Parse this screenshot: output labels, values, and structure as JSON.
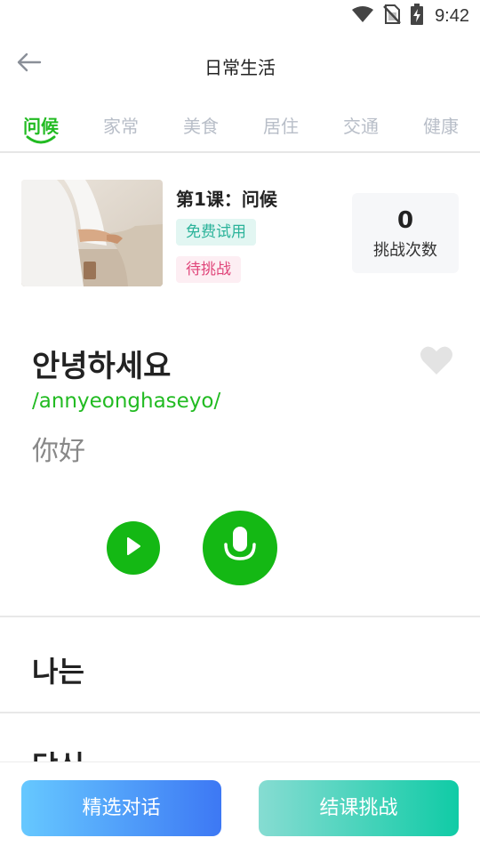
{
  "status_bar": {
    "time": "9:42",
    "icons": [
      "wifi-icon",
      "no-sim-icon",
      "battery-charging-icon"
    ]
  },
  "header": {
    "back_icon": "arrow-left-icon",
    "title": "日常生活"
  },
  "tabs": [
    {
      "label": "问候",
      "active": true
    },
    {
      "label": "家常",
      "active": false
    },
    {
      "label": "美食",
      "active": false
    },
    {
      "label": "居住",
      "active": false
    },
    {
      "label": "交通",
      "active": false
    },
    {
      "label": "健康",
      "active": false
    }
  ],
  "lesson": {
    "title": "第1课：问候",
    "badge_free": "免费试用",
    "badge_status": "待挑战",
    "challenge_count": "0",
    "challenge_label": "挑战次数"
  },
  "phrase": {
    "korean": "안녕하세요",
    "romanization": "/annyeonghaseyo/",
    "chinese": "你好",
    "favorite_icon": "heart-icon",
    "play_icon": "play-icon",
    "record_icon": "microphone-icon"
  },
  "list": [
    {
      "korean": "나는"
    },
    {
      "korean": "당신"
    }
  ],
  "bottom": {
    "dialog_button": "精选对话",
    "challenge_button": "结课挑战"
  },
  "colors": {
    "accent_green": "#14b814",
    "tab_inactive": "#b8bec8",
    "badge_free_text": "#2bb39a",
    "badge_pending_text": "#e0457a",
    "dialog_gradient": [
      "#66c8ff",
      "#3d78f4"
    ],
    "challenge_gradient": [
      "#86dcd2",
      "#10cba6"
    ]
  }
}
